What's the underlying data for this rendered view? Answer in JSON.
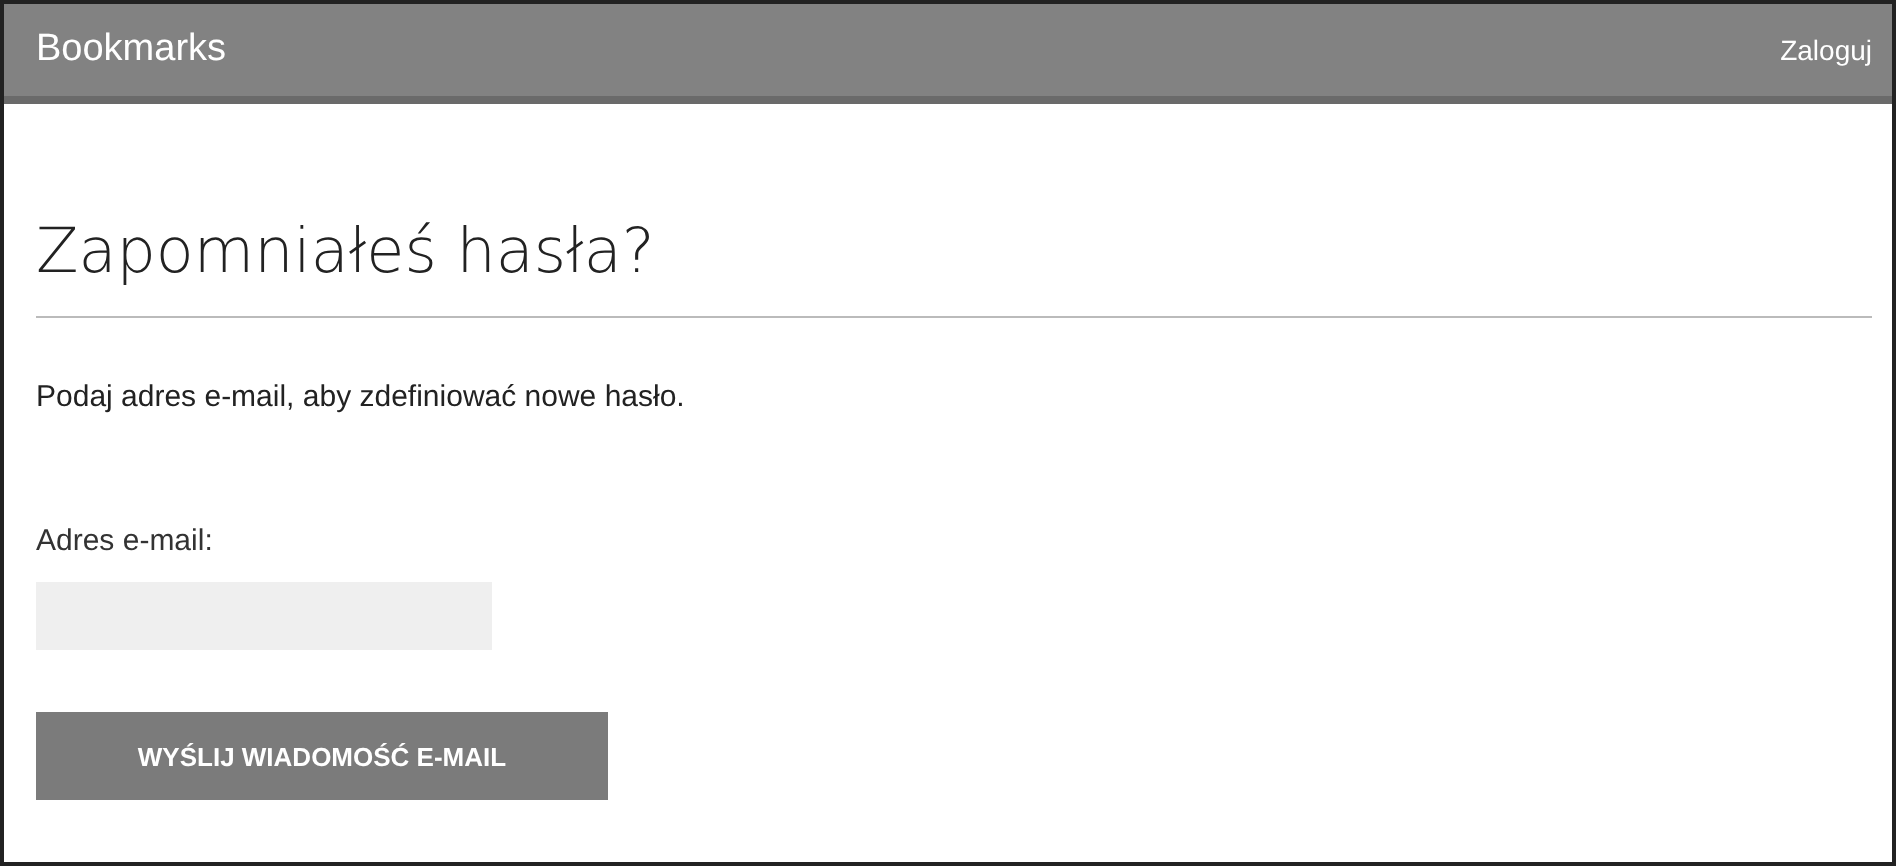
{
  "navbar": {
    "brand": "Bookmarks",
    "login_link": "Zaloguj"
  },
  "heading": "Zapomniałeś hasła?",
  "intro": "Podaj adres e-mail, aby zdefiniować nowe hasło.",
  "email_field": {
    "label": "Adres e-mail:"
  },
  "submit_button": "WYŚLIJ WIADOMOŚĆ E-MAIL"
}
